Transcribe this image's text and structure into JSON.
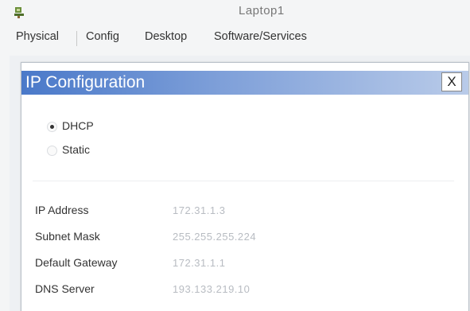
{
  "window": {
    "title": "Laptop1",
    "icon": "laptop-icon"
  },
  "tabs": [
    {
      "label": "Physical"
    },
    {
      "label": "Config"
    },
    {
      "label": "Desktop"
    },
    {
      "label": "Software/Services"
    }
  ],
  "dialog": {
    "title": "IP Configuration",
    "close_label": "X",
    "header_color": "#4a79c9"
  },
  "mode": {
    "selected": "DHCP",
    "options": [
      {
        "label": "DHCP",
        "checked": true
      },
      {
        "label": "Static",
        "checked": false
      }
    ]
  },
  "fields": [
    {
      "label": "IP Address",
      "value": "172.31.1.3"
    },
    {
      "label": "Subnet Mask",
      "value": "255.255.255.224"
    },
    {
      "label": "Default Gateway",
      "value": "172.31.1.1"
    },
    {
      "label": "DNS Server",
      "value": "193.133.219.10"
    }
  ]
}
